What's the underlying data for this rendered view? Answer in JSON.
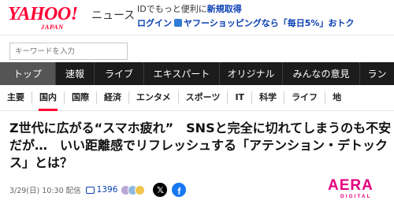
{
  "header": {
    "logo_text": "YAHOO!",
    "logo_sub": "JAPAN",
    "section_label": "ニュース",
    "promo_line1_prefix": "IDでもっと便利に",
    "promo_line1_link": "新規取得",
    "promo_line2_login": "ログイン",
    "promo_line2_text": "ヤフーショッピングなら「毎日5%」おトク",
    "brand_color": "#ff0033"
  },
  "search": {
    "placeholder": "キーワードを入力"
  },
  "topnav": {
    "items": [
      {
        "label": "トップ",
        "active": true
      },
      {
        "label": "速報"
      },
      {
        "label": "ライブ"
      },
      {
        "label": "エキスパート"
      },
      {
        "label": "オリジナル"
      },
      {
        "label": "みんなの意見"
      },
      {
        "label": "ラン"
      }
    ]
  },
  "subnav": {
    "items": [
      {
        "label": "主要"
      },
      {
        "label": "国内",
        "active": true
      },
      {
        "label": "国際"
      },
      {
        "label": "経済"
      },
      {
        "label": "エンタメ"
      },
      {
        "label": "スポーツ"
      },
      {
        "label": "IT"
      },
      {
        "label": "科学"
      },
      {
        "label": "ライフ"
      },
      {
        "label": "地"
      }
    ]
  },
  "article": {
    "headline": "Z世代に広がる“スマホ疲れ”　SNSと完全に切れてしまうのも不安だが…　いい距離感でリフレッシュする「アテンション・デトックス」とは？",
    "date": "3/29(日) 10:30",
    "delivery": "配信",
    "comment_count": "1396",
    "source_logo": "AERA",
    "source_logo_sub": "DIGITAL"
  },
  "icons": {
    "share_x": "x-icon",
    "share_facebook": "facebook-icon",
    "comments": "comment-icon"
  }
}
